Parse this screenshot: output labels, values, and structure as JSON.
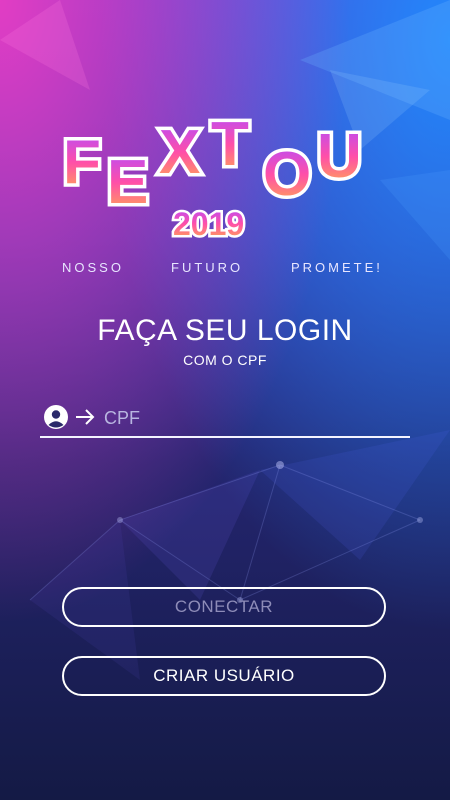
{
  "brand": {
    "logo_text": "FEXTOU",
    "logo_year": "2019",
    "tagline": [
      "NOSSO",
      "FUTURO",
      "PROMETE!"
    ]
  },
  "login": {
    "title": "FAÇA SEU LOGIN",
    "subtitle": "COM O CPF",
    "cpf_placeholder": "CPF",
    "cpf_value": "",
    "connect_label": "CONECTAR",
    "create_user_label": "CRIAR USUÁRIO"
  },
  "colors": {
    "bg_pink": "#e93dc4",
    "bg_blue": "#1e8cff",
    "bg_dark": "#141a45",
    "button_disabled_text": "#8e8cb8"
  },
  "icons": [
    "user-icon",
    "arrow-right-icon"
  ]
}
